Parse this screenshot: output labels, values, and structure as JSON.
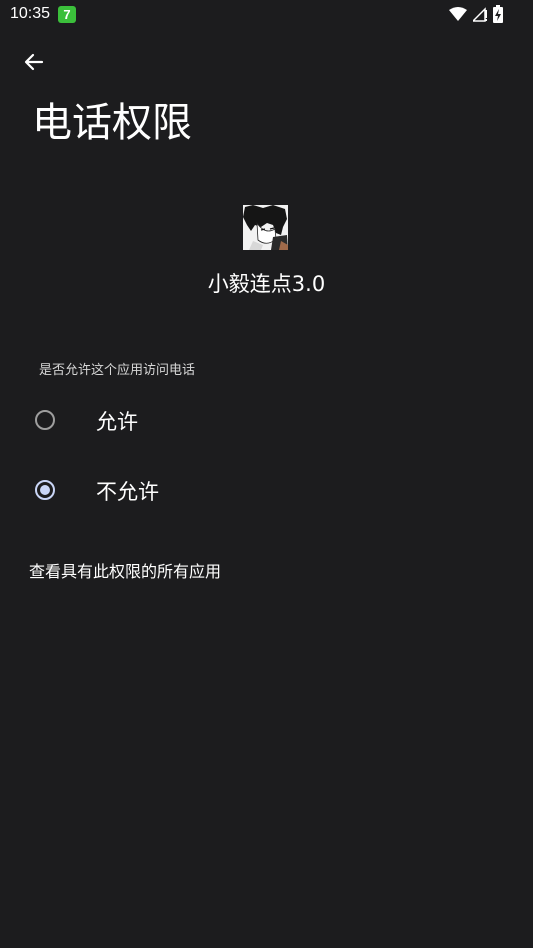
{
  "status_bar": {
    "time": "10:35",
    "notification_badge": "7",
    "icons": [
      "wifi-icon",
      "signal-icon",
      "battery-icon"
    ]
  },
  "header": {
    "back_icon": "arrow-left-icon",
    "title": "电话权限"
  },
  "app": {
    "name": "小毅连点3.0"
  },
  "permission": {
    "question": "是否允许这个应用访问电话",
    "options": [
      {
        "label": "允许",
        "selected": false
      },
      {
        "label": "不允许",
        "selected": true
      }
    ]
  },
  "footer_link": "查看具有此权限的所有应用",
  "colors": {
    "background": "#1c1c1e",
    "radio_selected": "#c9d5f6",
    "radio_unselected": "#9e9e9e",
    "badge": "#3bbf3b"
  }
}
